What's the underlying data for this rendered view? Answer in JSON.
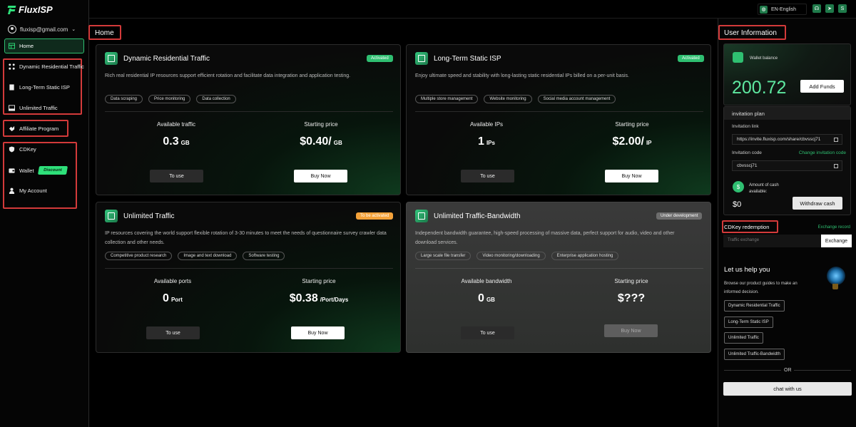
{
  "app": {
    "logo_text": "FluxISP",
    "user_email": "fluxisp@gmail.com"
  },
  "sidebar": {
    "home": "Home",
    "items": [
      {
        "label": "Dynamic Residential Traffic"
      },
      {
        "label": "Long-Term Static ISP"
      },
      {
        "label": "Unlimited Traffic"
      },
      {
        "label": "Affiliate Program"
      },
      {
        "label": "CDKey"
      },
      {
        "label": "Wallet"
      },
      {
        "label": "My Account"
      }
    ],
    "discount_badge": "Discount"
  },
  "topbar": {
    "language": "EN-English",
    "icons": [
      "headset-icon",
      "telegram-icon",
      "skype-icon"
    ]
  },
  "main": {
    "title": "Home",
    "cards": [
      {
        "title": "Dynamic Residential Traffic",
        "status": "Activated",
        "description": "Rich real residential IP resources support efficient rotation and facilitate data integration and application testing.",
        "tags": [
          "Data scraping",
          "Price monitoring",
          "Data collection"
        ],
        "metric_label": "Available traffic",
        "metric_value": "0.3",
        "metric_unit": "GB",
        "price_label": "Starting price",
        "price_value": "$0.40/",
        "price_unit": "GB",
        "use_label": "To use",
        "buy_label": "Buy Now"
      },
      {
        "title": "Long-Term Static ISP",
        "status": "Activated",
        "description": "Enjoy ultimate speed and stability with long-lasting static residential IPs billed on a per-unit basis.",
        "tags": [
          "Multiple store management",
          "Website monitoring",
          "Social media account management"
        ],
        "metric_label": "Available IPs",
        "metric_value": "1",
        "metric_unit": "IPs",
        "price_label": "Starting price",
        "price_value": "$2.00/",
        "price_unit": "IP",
        "use_label": "To use",
        "buy_label": "Buy Now"
      },
      {
        "title": "Unlimited Traffic",
        "status": "To be activated",
        "description_line1": "IP resources covering the world support flexible rotation of 3-30 minutes to meet the needs of questionnaire survey crawler data",
        "description_line2": "collection and other needs.",
        "tags": [
          "Competitive product research",
          "Image and text download",
          "Software testing"
        ],
        "metric_label": "Available ports",
        "metric_value": "0",
        "metric_unit": "Port",
        "price_label": "Starting price",
        "price_value": "$0.38",
        "price_unit": "/Port/Days",
        "use_label": "To use",
        "buy_label": "Buy Now"
      },
      {
        "title": "Unlimited Traffic-Bandwidth",
        "status": "Under development",
        "description_line1": "Independent bandwidth guarantee, high-speed processing of massive data, perfect support for audio, video and other",
        "description_line2": "download services.",
        "tags": [
          "Large scale file transfer",
          "Video monitoring/downloading",
          "Enterprise application hosting"
        ],
        "metric_label": "Available bandwidth",
        "metric_value": "0",
        "metric_unit": "GB",
        "price_label": "Starting price",
        "price_value": "$???",
        "use_label": "To use",
        "buy_label": "Buy Now"
      }
    ]
  },
  "user_info": {
    "title": "User Information",
    "wallet_label": "Wallet balance",
    "wallet_amount": "200.72",
    "add_funds": "Add Funds",
    "invitation_title": "invitation plan",
    "invitation_link_label": "Invitation link",
    "invitation_link": "https://invite.fluxisp.com/share/cbvsscj71",
    "invitation_code_label": "Invitation code",
    "change_code": "Change invitation code",
    "invitation_code": "cbvsscj71",
    "cash_label": "Amount of cash available:",
    "cash_value": "$0",
    "withdraw": "Withdraw cash",
    "cdkey_title": "CDKey redemption",
    "exchange_record": "Exchange record",
    "cdkey_placeholder": "Traffic exchange",
    "exchange_btn": "Exchange",
    "help_title": "Let us help you",
    "help_desc": "Browse our product guides to make an informed decision.",
    "guides": [
      "Dynamic Residential Traffic",
      "Long-Term Static ISP",
      "Unlimited Traffic",
      "Unlimited Traffic-Bandwidth"
    ],
    "or": "OR",
    "chat": "chat with us"
  }
}
